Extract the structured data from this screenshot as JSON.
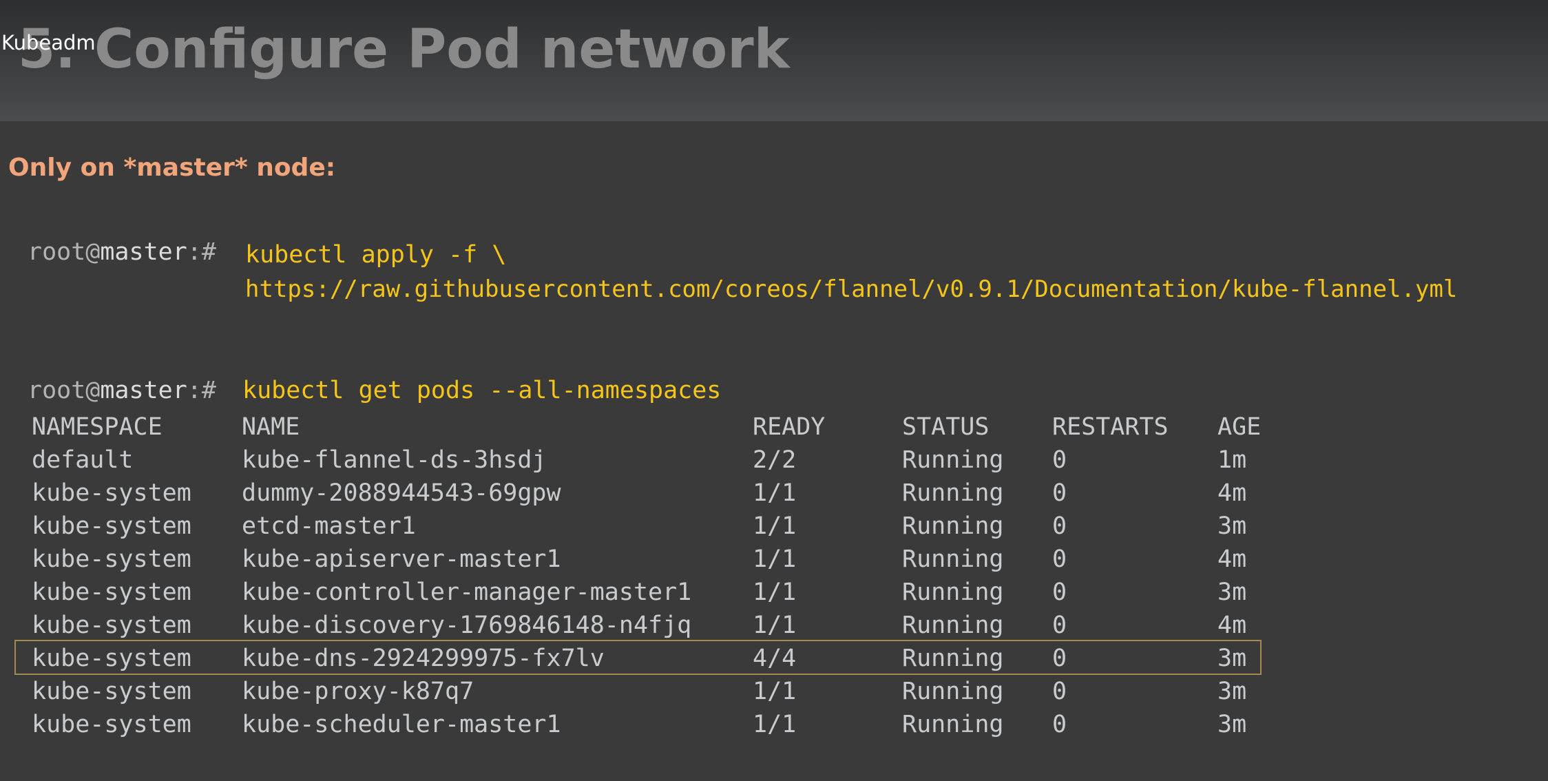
{
  "slide": {
    "title": "5. Configure Pod network",
    "caption": "Kubeadm",
    "note": "Only on *master* node:"
  },
  "terminal": {
    "prompt_user": "root@",
    "prompt_host": "master",
    "prompt_suffix": ":#",
    "command1_line1": "kubectl apply -f \\",
    "command1_line2": "https://raw.githubusercontent.com/coreos/flannel/v0.9.1/Documentation/kube-flannel.yml",
    "command2": "kubectl get pods --all-namespaces"
  },
  "pods_table": {
    "headers": [
      "NAMESPACE",
      "NAME",
      "READY",
      "STATUS",
      "RESTARTS",
      "AGE"
    ],
    "rows": [
      [
        "default",
        "kube-flannel-ds-3hsdj",
        "2/2",
        "Running",
        "0",
        "1m"
      ],
      [
        "kube-system",
        "dummy-2088944543-69gpw",
        "1/1",
        "Running",
        "0",
        "4m"
      ],
      [
        "kube-system",
        "etcd-master1",
        "1/1",
        "Running",
        "0",
        "3m"
      ],
      [
        "kube-system",
        "kube-apiserver-master1",
        "1/1",
        "Running",
        "0",
        "4m"
      ],
      [
        "kube-system",
        "kube-controller-manager-master1",
        "1/1",
        "Running",
        "0",
        "3m"
      ],
      [
        "kube-system",
        "kube-discovery-1769846148-n4fjq",
        "1/1",
        "Running",
        "0",
        "4m"
      ],
      [
        "kube-system",
        "kube-dns-2924299975-fx7lv",
        "4/4",
        "Running",
        "0",
        "3m"
      ],
      [
        "kube-system",
        "kube-proxy-k87q7",
        "1/1",
        "Running",
        "0",
        "3m"
      ],
      [
        "kube-system",
        "kube-scheduler-master1",
        "1/1",
        "Running",
        "0",
        "3m"
      ]
    ],
    "highlighted_row": 6
  },
  "colors": {
    "background": "#3a3a3b",
    "title_text": "#8a8a8b",
    "note_text": "#f2a57b",
    "command_text": "#f5c518",
    "output_text": "#c9cccf",
    "highlight_border": "#a48a4e"
  }
}
